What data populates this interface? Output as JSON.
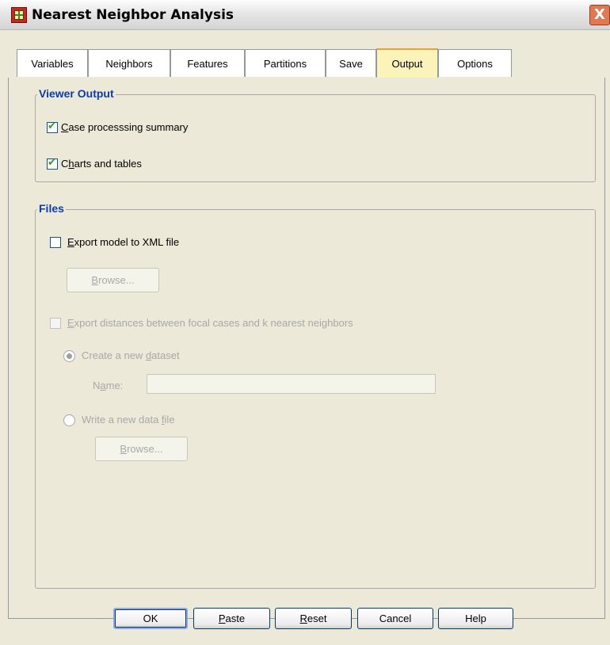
{
  "window": {
    "title": "Nearest Neighbor Analysis",
    "close_symbol": "X"
  },
  "tabs": [
    {
      "label": "Variables"
    },
    {
      "label": "Neighbors"
    },
    {
      "label": "Features"
    },
    {
      "label": "Partitions"
    },
    {
      "label": "Save"
    },
    {
      "label": "Output",
      "active": true
    },
    {
      "label": "Options"
    }
  ],
  "viewer_output": {
    "legend": "Viewer Output",
    "case_summary": {
      "checked": true,
      "mnemonic": "C",
      "rest": "ase processsing summary"
    },
    "charts_tables": {
      "checked": true,
      "before": "C",
      "mnemonic": "h",
      "rest": "arts and tables"
    }
  },
  "files": {
    "legend": "Files",
    "export_xml": {
      "checked": false,
      "mnemonic": "E",
      "rest": "xport model to XML file"
    },
    "browse1": {
      "mnemonic": "B",
      "rest": "rowse..."
    },
    "export_distances": {
      "checked": false,
      "enabled": false,
      "mnemonic": "E",
      "rest": "xport distances between focal cases and k nearest neighbors"
    },
    "create_dataset": {
      "selected": true,
      "before": "Create a new ",
      "mnemonic": "d",
      "rest": "ataset"
    },
    "name_field": {
      "before": "N",
      "mnemonic": "a",
      "rest": "me:",
      "value": ""
    },
    "write_file": {
      "selected": false,
      "before": "Write a new data ",
      "mnemonic": "f",
      "rest": "ile"
    },
    "browse2": {
      "mnemonic": "B",
      "rest": "rowse..."
    }
  },
  "buttons": {
    "ok": "OK",
    "paste": {
      "mnemonic": "P",
      "rest": "aste"
    },
    "reset": {
      "mnemonic": "R",
      "rest": "eset"
    },
    "cancel": "Cancel",
    "help": "Help"
  },
  "colors": {
    "legend": "#0d3ca8",
    "active_tab": "#fcf3ba",
    "check": "#21a121"
  }
}
